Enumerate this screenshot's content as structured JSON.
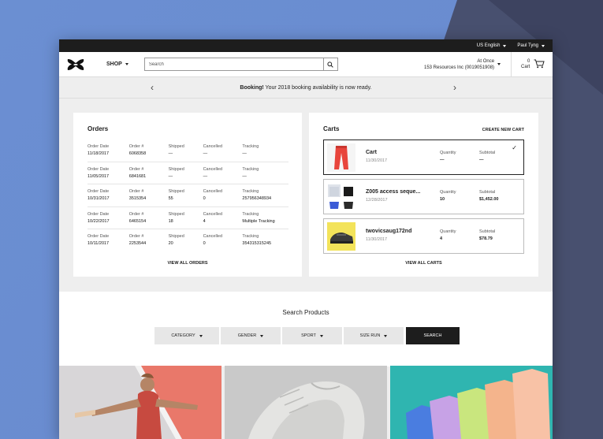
{
  "topbar": {
    "language": "US English",
    "user": "Paul Tyng"
  },
  "header": {
    "shop_label": "SHOP",
    "search_placeholder": "Search",
    "account_line1": "At Once",
    "account_line2": "153 Resources Inc (0019051908)",
    "cart_count": "0",
    "cart_label": "Cart"
  },
  "banner": {
    "bold": "Booking!",
    "text": " Your 2018 booking availability is now ready."
  },
  "orders": {
    "title": "Orders",
    "columns": [
      "Order Date",
      "Order #",
      "Shipped",
      "Cancelled",
      "Tracking"
    ],
    "rows": [
      [
        "11/18/2017",
        "6068358",
        "—",
        "—",
        "—"
      ],
      [
        "11/05/2017",
        "6841681",
        "—",
        "—",
        "—"
      ],
      [
        "10/31/2017",
        "3515354",
        "55",
        "0",
        "257956348934"
      ],
      [
        "10/22/2017",
        "6465154",
        "18",
        "4",
        "Multiple Tracking"
      ],
      [
        "10/11/2017",
        "2253544",
        "20",
        "0",
        "354315315245"
      ]
    ],
    "view_all": "VIEW ALL ORDERS"
  },
  "carts": {
    "title": "Carts",
    "create": "CREATE NEW CART",
    "quantity_label": "Quantity",
    "subtotal_label": "Subtotal",
    "items": [
      {
        "name": "Cart",
        "date": "11/30/2017",
        "quantity": "—",
        "subtotal": "—",
        "selected": true
      },
      {
        "name": "Z005 access seque...",
        "date": "12/28/2017",
        "quantity": "10",
        "subtotal": "$1,452.00",
        "selected": false
      },
      {
        "name": "twovicsaug172nd",
        "date": "11/30/2017",
        "quantity": "4",
        "subtotal": "$78.79",
        "selected": false
      }
    ],
    "view_all": "VIEW ALL CARTS"
  },
  "search_products": {
    "title": "Search Products",
    "filters": [
      "CATEGORY",
      "GENDER",
      "SPORT",
      "SIZE RUN"
    ],
    "search_button": "SEARCH"
  }
}
